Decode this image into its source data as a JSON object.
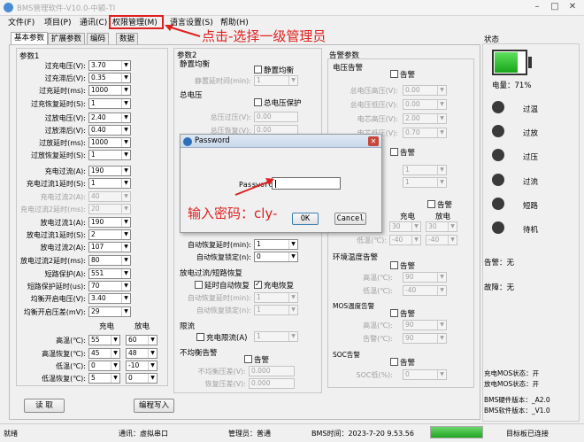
{
  "window": {
    "title": "BMS管理软件-V10.0-中颖-TI",
    "minimize": "–",
    "maximize": "□",
    "close": "✕"
  },
  "menu": [
    "文件(F)",
    "项目(P)",
    "通讯(C)",
    "权限管理(M)",
    "语言设置(S)",
    "帮助(H)"
  ],
  "annotations": {
    "menu_hint": "点击-选择一级管理员",
    "password_hint": "输入密码：cly-"
  },
  "tabs": [
    "基本参数",
    "扩展参数",
    "编码",
    "数据"
  ],
  "params1": {
    "title": "参数1",
    "rows": [
      {
        "label": "过充电压(V):",
        "value": "3.70",
        "enabled": true
      },
      {
        "label": "过充滞后(V):",
        "value": "0.35",
        "enabled": true
      },
      {
        "label": "过充延时(ms):",
        "value": "1000",
        "enabled": true
      },
      {
        "label": "过充恢复延时(S):",
        "value": "1",
        "enabled": true
      },
      {
        "label": "过放电压(V):",
        "value": "2.40",
        "enabled": true
      },
      {
        "label": "过放滞后(V):",
        "value": "0.40",
        "enabled": true
      },
      {
        "label": "过放延时(ms):",
        "value": "1000",
        "enabled": true
      },
      {
        "label": "过放恢复延时(S):",
        "value": "1",
        "enabled": true
      },
      {
        "label": "充电过流(A):",
        "value": "190",
        "enabled": true
      },
      {
        "label": "充电过流1延时(S):",
        "value": "1",
        "enabled": true
      },
      {
        "label": "充电过流2(A):",
        "value": "40",
        "enabled": false
      },
      {
        "label": "充电过流2延时(ms):",
        "value": "20",
        "enabled": false
      },
      {
        "label": "放电过流1(A):",
        "value": "190",
        "enabled": true
      },
      {
        "label": "放电过流1延时(S):",
        "value": "2",
        "enabled": true
      },
      {
        "label": "放电过流2(A):",
        "value": "107",
        "enabled": true
      },
      {
        "label": "放电过流2延时(ms):",
        "value": "80",
        "enabled": true
      },
      {
        "label": "短路保护(A):",
        "value": "551",
        "enabled": true
      },
      {
        "label": "短路保护延时(us):",
        "value": "70",
        "enabled": true
      },
      {
        "label": "均衡开启电压(V):",
        "value": "3.40",
        "enabled": true
      },
      {
        "label": "均衡开启压差(mV):",
        "value": "29",
        "enabled": true
      }
    ],
    "temp": {
      "head_charge": "充电",
      "head_discharge": "放电",
      "rows": [
        {
          "label": "高温(℃):",
          "charge": "55",
          "discharge": "60"
        },
        {
          "label": "高温恢复(℃):",
          "charge": "45",
          "discharge": "48"
        },
        {
          "label": "低温(℃):",
          "charge": "0",
          "discharge": "-10"
        },
        {
          "label": "低温恢复(℃):",
          "charge": "5",
          "discharge": "0"
        }
      ]
    }
  },
  "params2": {
    "title": "参数2",
    "static_balance": {
      "title": "静置均衡",
      "check_label": "静置均衡",
      "delay_label": "静置延时间(min):",
      "delay_value": "1"
    },
    "total_voltage": {
      "title": "总电压",
      "check_label": "总电压保护",
      "ov_label": "总压过压(V):",
      "ov_value": "0.00",
      "ovr_label": "总压恢复(V):",
      "ovr_value": "0.00"
    },
    "auto_recover": {
      "delay_label": "自动恢复延时(min):",
      "delay_value": "1",
      "lock_label": "自动恢复锁定(n):",
      "lock_value": "0"
    },
    "discharge_oc": {
      "title": "放电过流/短路恢复",
      "delay_check": "延时自动恢复",
      "charge_check": "充电恢复",
      "delay_label": "自动恢复延时(min):",
      "delay_value": "1",
      "lock_label": "自动恢复锁定(n):",
      "lock_value": "1"
    },
    "current_limit": {
      "title": "限流",
      "check_label": "充电限流(A)",
      "value": "1"
    },
    "imbalance": {
      "title": "不均衡告警",
      "check_label": "告警",
      "pressure_label": "不均衡压差(V):",
      "pressure_value": "0.000",
      "recover_label": "恢复压差(V):",
      "recover_value": "0.000"
    }
  },
  "alarms": {
    "title": "告警参数",
    "voltage": {
      "title": "电压告警",
      "check_label": "告警",
      "rows": [
        {
          "label": "总电压高压(V):",
          "value": "0.00"
        },
        {
          "label": "总电压低压(V):",
          "value": "0.00"
        },
        {
          "label": "电芯高压(V):",
          "value": "2.00"
        },
        {
          "label": "电芯低压(V):",
          "value": "0.70"
        }
      ]
    },
    "current": {
      "check_label": "告警",
      "rows": [
        {
          "value": "1"
        },
        {
          "value": "1"
        }
      ]
    },
    "temp": {
      "check_label": "告警",
      "head_charge": "充电",
      "head_discharge": "放电",
      "rows": [
        {
          "label": "高温(℃):",
          "charge": "30",
          "discharge": "30"
        },
        {
          "label": "低温(℃):",
          "charge": "-40",
          "discharge": "-40"
        }
      ]
    },
    "env": {
      "title": "环境温度告警",
      "check_label": "告警",
      "rows": [
        {
          "label": "高温(℃):",
          "value": "90"
        },
        {
          "label": "低温(℃):",
          "value": "-40"
        }
      ]
    },
    "mos": {
      "title": "MOS温度告警",
      "check_label": "告警",
      "rows": [
        {
          "label": "高温(℃):",
          "value": "90"
        },
        {
          "label": "告警(℃):",
          "value": "90"
        }
      ]
    },
    "soc": {
      "title": "SOC告警",
      "check_label": "告警",
      "label": "SOC低(%):",
      "value": "0"
    }
  },
  "status": {
    "title": "状态",
    "battery_label": "电量：71%",
    "battery_fraction": 0.71,
    "indicators": [
      "过温",
      "过放",
      "过压",
      "过流",
      "短路",
      "待机"
    ],
    "alarm": "告警：无",
    "fault": "故障：无",
    "info": [
      "充电MOS状态：开",
      "放电MOS状态：开",
      "BMS硬件版本：_A2.0",
      "BMS软件版本：_V1.0"
    ]
  },
  "buttons": {
    "read": "读 取",
    "write": "编程写入"
  },
  "password_dialog": {
    "title": "Password",
    "label": "Password:",
    "value": "",
    "ok": "OK",
    "cancel": "Cancel"
  },
  "statusbar": {
    "ready": "就绪",
    "comm": "通讯：虚拟串口",
    "admin": "管理员：普通",
    "time": "BMS时间：2023-7-20 9.53.56",
    "board": "目标板已连接"
  }
}
